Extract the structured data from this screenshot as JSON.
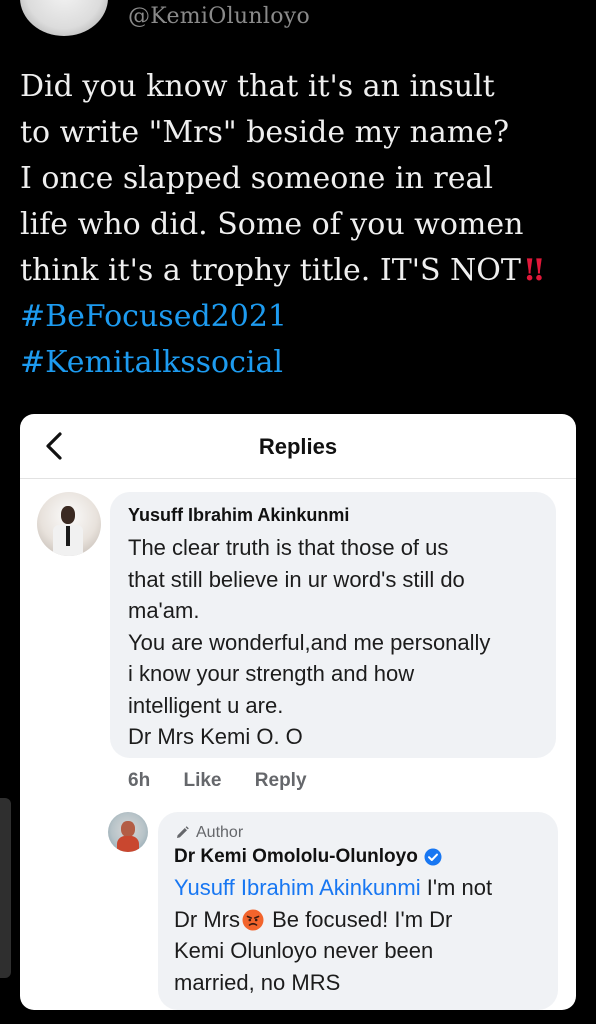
{
  "tweet": {
    "handle": "@KemiOlunloyo",
    "lines": [
      "Did you know that it's an insult",
      "to write \"Mrs\" beside my name?",
      "I once slapped someone in real",
      "life who did. Some of you women",
      "think it's a trophy title. IT'S NOT"
    ],
    "emphasis": "‼",
    "hashtags": [
      "#BeFocused2021",
      "#Kemitalkssocial"
    ]
  },
  "card": {
    "header_title": "Replies",
    "back_icon": "chevron-left-icon",
    "comment": {
      "author": "Yusuff Ibrahim Akinkunmi",
      "lines": [
        "The clear truth is that those of us",
        "that still believe in ur word's still do",
        "ma'am.",
        "You are wonderful,and me personally",
        "i know your strength and how",
        "intelligent u are.",
        "Dr Mrs Kemi O. O"
      ],
      "time": "6h",
      "like_label": "Like",
      "reply_label": "Reply"
    },
    "reply": {
      "badge": "Author",
      "author": "Dr Kemi Omololu-Olunloyo",
      "mention": "Yusuff Ibrahim Akinkunmi",
      "line1_rest": " I'm not",
      "line2_pre": "Dr Mrs",
      "line2_post": " Be focused! I'm Dr",
      "line3": "Kemi Olunloyo never been",
      "line4": "married, no MRS"
    }
  },
  "colors": {
    "background": "#000000",
    "tweet_text": "#efefef",
    "hashtag": "#1d9bf0",
    "mention": "#1877f2",
    "bubble": "#f0f2f5",
    "verified": "#1877f2"
  }
}
